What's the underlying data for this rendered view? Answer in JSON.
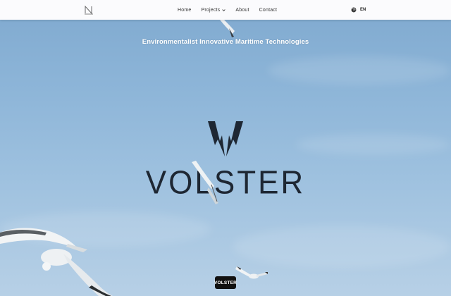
{
  "nav": {
    "logo": "N",
    "links": [
      {
        "label": "Home"
      },
      {
        "label": "Projects"
      },
      {
        "label": "About"
      },
      {
        "label": "Contact"
      }
    ],
    "language": "EN"
  },
  "hero": {
    "tagline": "Environmentalist Innovative Maritime Technologies",
    "brand": "VOLSTER",
    "badge": "VOLSTER"
  },
  "icons": {
    "logo": "n-logo-icon",
    "projects_dropdown": "chevron-down-icon",
    "language": "globe-icon",
    "brand_mark": "lightning-bolts-icon"
  },
  "colors": {
    "nav_bg": "#fbfbfd",
    "sky_top": "#7fa9cf",
    "sky_bottom": "#b7d0e6",
    "brand_text": "#1e2733",
    "badge_bg": "#111111"
  }
}
